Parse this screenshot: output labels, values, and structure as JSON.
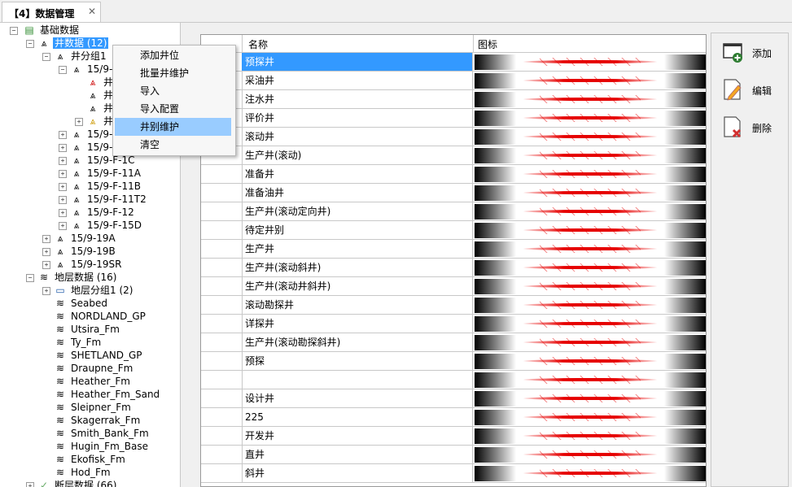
{
  "tab": {
    "title": "【4】数据管理",
    "close_glyph": "✕"
  },
  "tree": {
    "root_label": "基础数据",
    "wells_label": "井数据 (12)",
    "well_group_label": "井分组1",
    "well_group_count_hint": "(",
    "well_a": "15/9-",
    "well_a_children": [
      "井",
      "井",
      "井",
      "井"
    ],
    "wells_group_items": [
      "15/9-",
      "15/9-",
      "15/9-F-1C",
      "15/9-F-11A",
      "15/9-F-11B",
      "15/9-F-11T2",
      "15/9-F-12",
      "15/9-F-15D"
    ],
    "wells_top": [
      "15/9-19A",
      "15/9-19B",
      "15/9-19SR"
    ],
    "formation_label": "地层数据 (16)",
    "formation_group_label": "地层分组1 (2)",
    "formations": [
      "Seabed",
      "NORDLAND_GP",
      "Utsira_Fm",
      "Ty_Fm",
      "SHETLAND_GP",
      "Draupne_Fm",
      "Heather_Fm",
      "Heather_Fm_Sand",
      "Sleipner_Fm",
      "Skagerrak_Fm",
      "Smith_Bank_Fm",
      "Hugin_Fm_Base",
      "Ekofisk_Fm",
      "Hod_Fm"
    ],
    "fault_label": "断层数据 (66)"
  },
  "context_menu": {
    "items": [
      "添加井位",
      "批量井维护",
      "导入",
      "导入配置",
      "井别维护",
      "清空"
    ],
    "highlighted": "井别维护"
  },
  "grid": {
    "columns": {
      "name": "名称",
      "icon": "图标"
    },
    "rows": [
      "预探井",
      "采油井",
      "注水井",
      "评价井",
      "滚动井",
      "生产井(滚动)",
      "准备井",
      "准备油井",
      "生产井(滚动定向井)",
      "待定井别",
      "生产井",
      "生产井(滚动斜井)",
      "生产井(滚动井斜井)",
      "滚动勘探井",
      "详探井",
      "生产井(滚动勘探斜井)",
      "预探",
      "",
      "设计井",
      "225",
      "开发井",
      "直井",
      "斜井"
    ],
    "selected_row": "预探井"
  },
  "side_buttons": {
    "add": "添加",
    "edit": "编辑",
    "delete": "删除"
  },
  "colors": {
    "selection": "#3399ff",
    "menu_highlight": "#99ccff",
    "symbol_red": "#e60000"
  }
}
